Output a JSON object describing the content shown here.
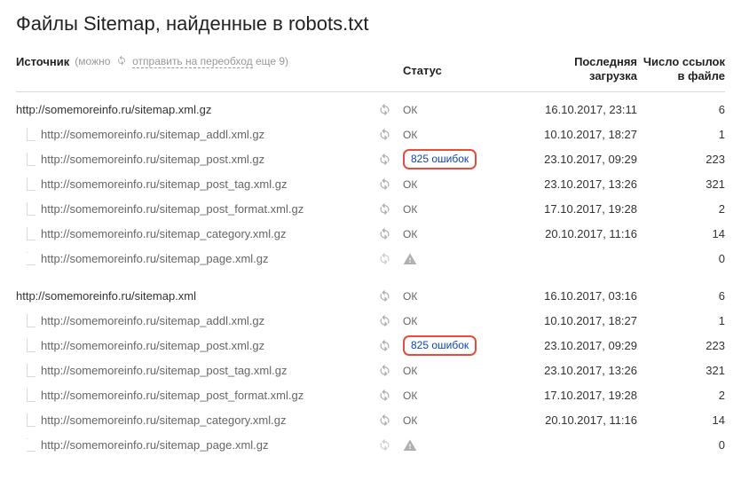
{
  "title": "Файлы Sitemap, найденные в robots.txt",
  "header": {
    "source_label": "Источник",
    "hint_prefix": "(можно",
    "hint_link": "отправить на переобход",
    "hint_suffix": "еще 9)",
    "status_label": "Статус",
    "date_line1": "Последняя",
    "date_line2": "загрузка",
    "links_line1": "Число ссылок",
    "links_line2": "в файле"
  },
  "status_ok_text": "ОК",
  "groups": [
    {
      "parent": {
        "url": "http://somemoreinfo.ru/sitemap.xml.gz",
        "status": "ok",
        "date": "16.10.2017, 23:11",
        "links": "6",
        "refresh": "active"
      },
      "children": [
        {
          "url": "http://somemoreinfo.ru/sitemap_addl.xml.gz",
          "status": "ok",
          "date": "10.10.2017, 18:27",
          "links": "1",
          "refresh": "active"
        },
        {
          "url": "http://somemoreinfo.ru/sitemap_post.xml.gz",
          "status": "error",
          "error_text": "825 ошибок",
          "date": "23.10.2017, 09:29",
          "links": "223",
          "refresh": "active"
        },
        {
          "url": "http://somemoreinfo.ru/sitemap_post_tag.xml.gz",
          "status": "ok",
          "date": "23.10.2017, 13:26",
          "links": "321",
          "refresh": "active"
        },
        {
          "url": "http://somemoreinfo.ru/sitemap_post_format.xml.gz",
          "status": "ok",
          "date": "17.10.2017, 19:28",
          "links": "2",
          "refresh": "active"
        },
        {
          "url": "http://somemoreinfo.ru/sitemap_category.xml.gz",
          "status": "ok",
          "date": "20.10.2017, 11:16",
          "links": "14",
          "refresh": "active"
        },
        {
          "url": "http://somemoreinfo.ru/sitemap_page.xml.gz",
          "status": "warn",
          "date": "",
          "links": "0",
          "refresh": "inactive"
        }
      ]
    },
    {
      "parent": {
        "url": "http://somemoreinfo.ru/sitemap.xml",
        "status": "ok",
        "date": "16.10.2017, 03:16",
        "links": "6",
        "refresh": "active"
      },
      "children": [
        {
          "url": "http://somemoreinfo.ru/sitemap_addl.xml.gz",
          "status": "ok",
          "date": "10.10.2017, 18:27",
          "links": "1",
          "refresh": "active"
        },
        {
          "url": "http://somemoreinfo.ru/sitemap_post.xml.gz",
          "status": "error",
          "error_text": "825 ошибок",
          "date": "23.10.2017, 09:29",
          "links": "223",
          "refresh": "active"
        },
        {
          "url": "http://somemoreinfo.ru/sitemap_post_tag.xml.gz",
          "status": "ok",
          "date": "23.10.2017, 13:26",
          "links": "321",
          "refresh": "active"
        },
        {
          "url": "http://somemoreinfo.ru/sitemap_post_format.xml.gz",
          "status": "ok",
          "date": "17.10.2017, 19:28",
          "links": "2",
          "refresh": "active"
        },
        {
          "url": "http://somemoreinfo.ru/sitemap_category.xml.gz",
          "status": "ok",
          "date": "20.10.2017, 11:16",
          "links": "14",
          "refresh": "active"
        },
        {
          "url": "http://somemoreinfo.ru/sitemap_page.xml.gz",
          "status": "warn",
          "date": "",
          "links": "0",
          "refresh": "inactive"
        }
      ]
    }
  ]
}
